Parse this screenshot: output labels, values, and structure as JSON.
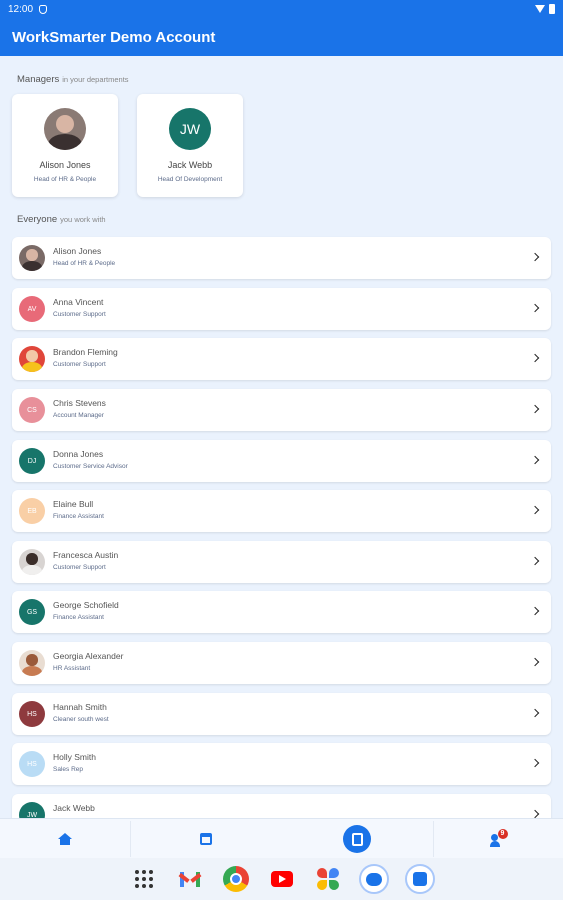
{
  "status_bar": {
    "time": "12:00"
  },
  "app_bar": {
    "title": "WorkSmarter Demo Account"
  },
  "managers_section": {
    "title": "Managers",
    "subtitle": "in your departments"
  },
  "managers": [
    {
      "name": "Alison Jones",
      "role": "Head of HR & People",
      "avatar_type": "photo"
    },
    {
      "name": "Jack Webb",
      "role": "Head Of Development",
      "initials": "JW",
      "avatar_color": "#17756a"
    }
  ],
  "everyone_section": {
    "title": "Everyone",
    "subtitle": "you work with"
  },
  "people": [
    {
      "name": "Alison Jones",
      "role": "Head of HR & People",
      "avatar_type": "photo",
      "initials": "",
      "avatar_color": "#7a6a66"
    },
    {
      "name": "Anna Vincent",
      "role": "Customer Support",
      "initials": "AV",
      "avatar_color": "#e86a78"
    },
    {
      "name": "Brandon Fleming",
      "role": "Customer Support",
      "avatar_type": "photo",
      "initials": "",
      "avatar_color": "#e0463a"
    },
    {
      "name": "Chris Stevens",
      "role": "Account Manager",
      "initials": "CS",
      "avatar_color": "#e8909a"
    },
    {
      "name": "Donna Jones",
      "role": "Customer Service Advisor",
      "initials": "DJ",
      "avatar_color": "#17756a"
    },
    {
      "name": "Elaine Bull",
      "role": "Finance Assistant",
      "initials": "EB",
      "avatar_color": "#f9cfa6"
    },
    {
      "name": "Francesca Austin",
      "role": "Customer Support",
      "avatar_type": "photo",
      "initials": "",
      "avatar_color": "#d8d4d2"
    },
    {
      "name": "George Schofield",
      "role": "Finance Assistant",
      "initials": "GS",
      "avatar_color": "#17756a"
    },
    {
      "name": "Georgia Alexander",
      "role": "HR Assistant",
      "avatar_type": "photo",
      "initials": "",
      "avatar_color": "#e9ddd2"
    },
    {
      "name": "Hannah Smith",
      "role": "Cleaner south west",
      "initials": "HS",
      "avatar_color": "#8e3a3e"
    },
    {
      "name": "Holly Smith",
      "role": "Sales Rep",
      "initials": "HS",
      "avatar_color": "#b9dcf5"
    },
    {
      "name": "Jack Webb",
      "role": "",
      "initials": "JW",
      "avatar_color": "#17756a"
    }
  ],
  "bottom_nav": {
    "items": [
      {
        "icon": "home-icon"
      },
      {
        "icon": "calendar-icon"
      },
      {
        "icon": "directory-icon"
      },
      {
        "icon": "people-icon",
        "badge": "9"
      }
    ]
  },
  "dock": {
    "apps": [
      "app-drawer-icon",
      "gmail-icon",
      "chrome-icon",
      "youtube-icon",
      "photos-icon",
      "messages-icon",
      "worksmarter-icon"
    ]
  },
  "colors": {
    "primary": "#1a73e8",
    "background": "#eaf2fd",
    "card": "#ffffff",
    "badge": "#d93025"
  }
}
